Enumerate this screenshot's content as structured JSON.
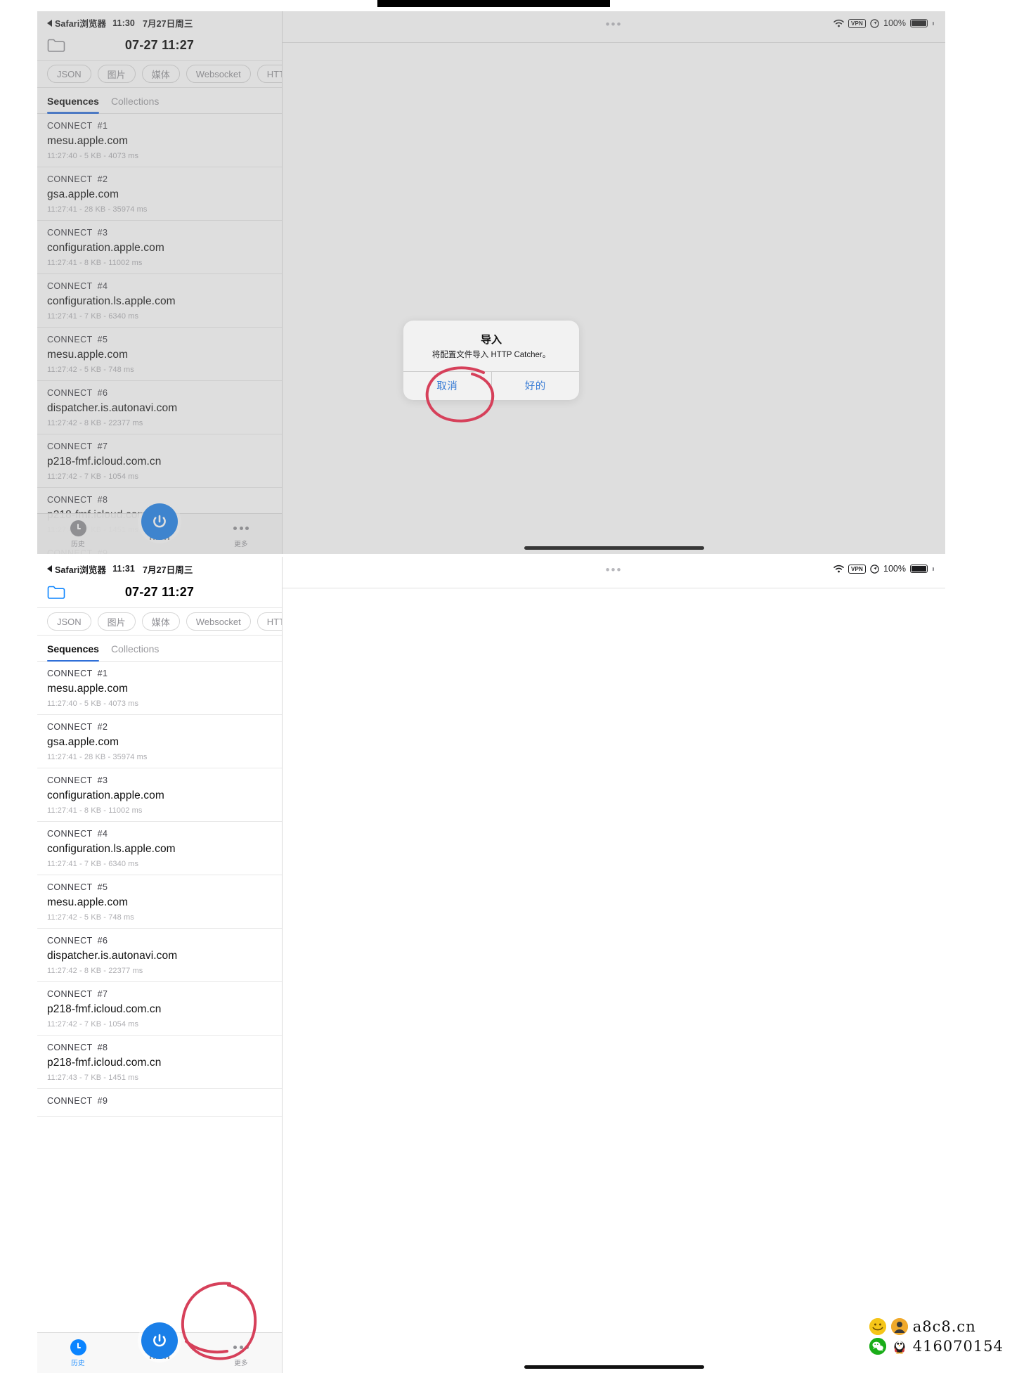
{
  "statusbar": {
    "back_label": "Safari浏览器",
    "time_top": "11:30",
    "time_bottom": "11:31",
    "date": "7月27日周三",
    "battery_pct": "100%",
    "vpn": "VPN"
  },
  "navbar": {
    "title": "07-27 11:27",
    "folder_icon": "folder-icon"
  },
  "chips": [
    {
      "label": "JSON"
    },
    {
      "label": "图片"
    },
    {
      "label": "媒体"
    },
    {
      "label": "Websocket"
    },
    {
      "label": "HTT"
    }
  ],
  "segments": [
    {
      "label": "Sequences",
      "active": true
    },
    {
      "label": "Collections",
      "active": false
    }
  ],
  "rows": [
    {
      "method": "CONNECT",
      "num": "#1",
      "host": "mesu.apple.com",
      "meta": "11:27:40 - 5 KB - 4073 ms"
    },
    {
      "method": "CONNECT",
      "num": "#2",
      "host": "gsa.apple.com",
      "meta": "11:27:41 - 28 KB - 35974 ms"
    },
    {
      "method": "CONNECT",
      "num": "#3",
      "host": "configuration.apple.com",
      "meta": "11:27:41 - 8 KB - 11002 ms"
    },
    {
      "method": "CONNECT",
      "num": "#4",
      "host": "configuration.ls.apple.com",
      "meta": "11:27:41 - 7 KB - 6340 ms"
    },
    {
      "method": "CONNECT",
      "num": "#5",
      "host": "mesu.apple.com",
      "meta": "11:27:42 - 5 KB - 748 ms"
    },
    {
      "method": "CONNECT",
      "num": "#6",
      "host": "dispatcher.is.autonavi.com",
      "meta": "11:27:42 - 8 KB - 22377 ms"
    },
    {
      "method": "CONNECT",
      "num": "#7",
      "host": "p218-fmf.icloud.com.cn",
      "meta": "11:27:42 - 7 KB - 1054 ms"
    },
    {
      "method": "CONNECT",
      "num": "#8",
      "host": "p218-fmf.icloud.com.cn",
      "meta": "11:27:43 - 7 KB - 1451 ms"
    },
    {
      "method": "CONNECT",
      "num": "#9",
      "host": "",
      "meta": ""
    }
  ],
  "tabbar": {
    "history_label": "历史",
    "more_label": "更多",
    "power_label": "power-button",
    "ghost_label": "n.cn"
  },
  "modal": {
    "title": "导入",
    "message": "将配置文件导入 HTTP Catcher。",
    "cancel": "取消",
    "confirm": "好的"
  },
  "detail": {
    "dots": "•••"
  },
  "watermark": {
    "site": "a8c8.cn",
    "qq": "416070154"
  },
  "colors": {
    "accent_blue": "#0a84ff",
    "power_blue": "#1a7fe8",
    "segment_blue": "#2f6fd8",
    "annotation_red": "#d6405a",
    "link_blue": "#3d7fd6"
  }
}
